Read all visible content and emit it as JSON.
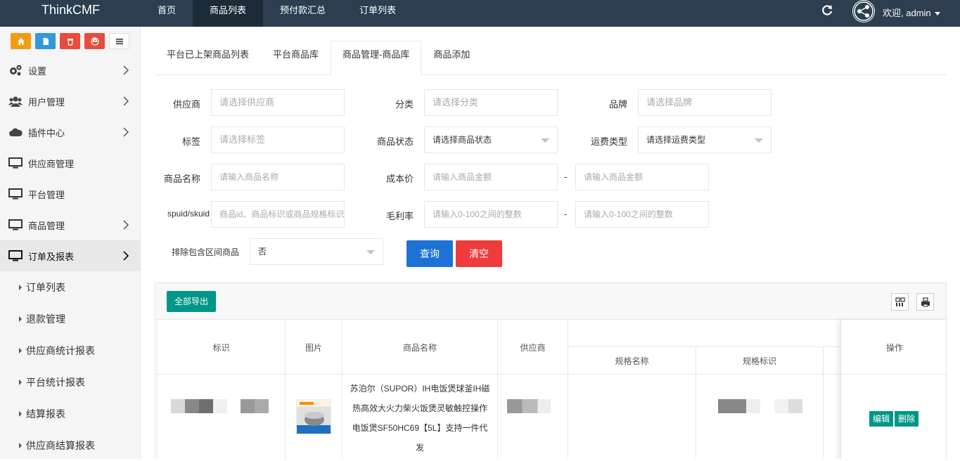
{
  "app": {
    "brand": "ThinkCMF",
    "welcome": "欢迎, admin"
  },
  "topnav": [
    {
      "label": "首页",
      "active": false
    },
    {
      "label": "商品列表",
      "active": true
    },
    {
      "label": "预付款汇总",
      "active": false
    },
    {
      "label": "订单列表",
      "active": false
    }
  ],
  "toolbar_colors": {
    "home": "#f39c12",
    "file": "#3498db",
    "trash": "#e74c3c",
    "recycle": "#e74c3c"
  },
  "sidebar": {
    "items": [
      {
        "label": "设置",
        "icon": "gears-icon",
        "chevron": true
      },
      {
        "label": "用户管理",
        "icon": "users-icon",
        "chevron": true
      },
      {
        "label": "插件中心",
        "icon": "cloud-icon",
        "chevron": true
      },
      {
        "label": "供应商管理",
        "icon": "monitor-icon",
        "chevron": false
      },
      {
        "label": "平台管理",
        "icon": "monitor-icon",
        "chevron": false
      },
      {
        "label": "商品管理",
        "icon": "monitor-icon",
        "chevron": true
      },
      {
        "label": "订单及报表",
        "icon": "monitor-icon",
        "chevron": true,
        "active": true
      }
    ],
    "subitems": [
      "订单列表",
      "退款管理",
      "供应商统计报表",
      "平台统计报表",
      "结算报表",
      "供应商结算报表"
    ]
  },
  "tabs": [
    "平台已上架商品列表",
    "平台商品库",
    "商品管理-商品库",
    "商品添加"
  ],
  "active_tab": 2,
  "filters": {
    "supplier": {
      "label": "供应商",
      "placeholder": "请选择供应商"
    },
    "category": {
      "label": "分类",
      "placeholder": "请选择分类"
    },
    "brand": {
      "label": "品牌",
      "placeholder": "请选择品牌"
    },
    "tag": {
      "label": "标签",
      "placeholder": "请选择标签"
    },
    "status": {
      "label": "商品状态",
      "value": "请选择商品状态"
    },
    "shipping": {
      "label": "运费类型",
      "value": "请选择运费类型"
    },
    "name": {
      "label": "商品名称",
      "placeholder": "请输入商品名称"
    },
    "cost": {
      "label": "成本价",
      "placeholder_min": "请输入商品金额",
      "placeholder_max": "请输入商品金额"
    },
    "spuid": {
      "label": "spuid/skuid",
      "placeholder": "商品id、商品标识或商品规格标识"
    },
    "margin": {
      "label": "毛利率",
      "placeholder_min": "请输入0-100之间的整数",
      "placeholder_max": "请输入0-100之间的整数"
    },
    "exclude": {
      "label": "排除包含区间商品",
      "value": "否"
    },
    "dash": "-"
  },
  "buttons": {
    "search": "查询",
    "clear": "清空",
    "export": "全部导出",
    "edit": "编辑",
    "delete": "删除"
  },
  "table": {
    "headers": {
      "id": "标识",
      "image": "图片",
      "name": "商品名称",
      "supplier": "供应商",
      "spec_name": "规格名称",
      "spec_id": "规格标识",
      "ops": "操作"
    },
    "rows": [
      {
        "name": "苏泊尔（SUPOR）IH电饭煲球釜IH磁热高效大火力柴火饭煲灵敏触控操作电饭煲SF50HC69【5L】支持一件代发"
      }
    ]
  }
}
